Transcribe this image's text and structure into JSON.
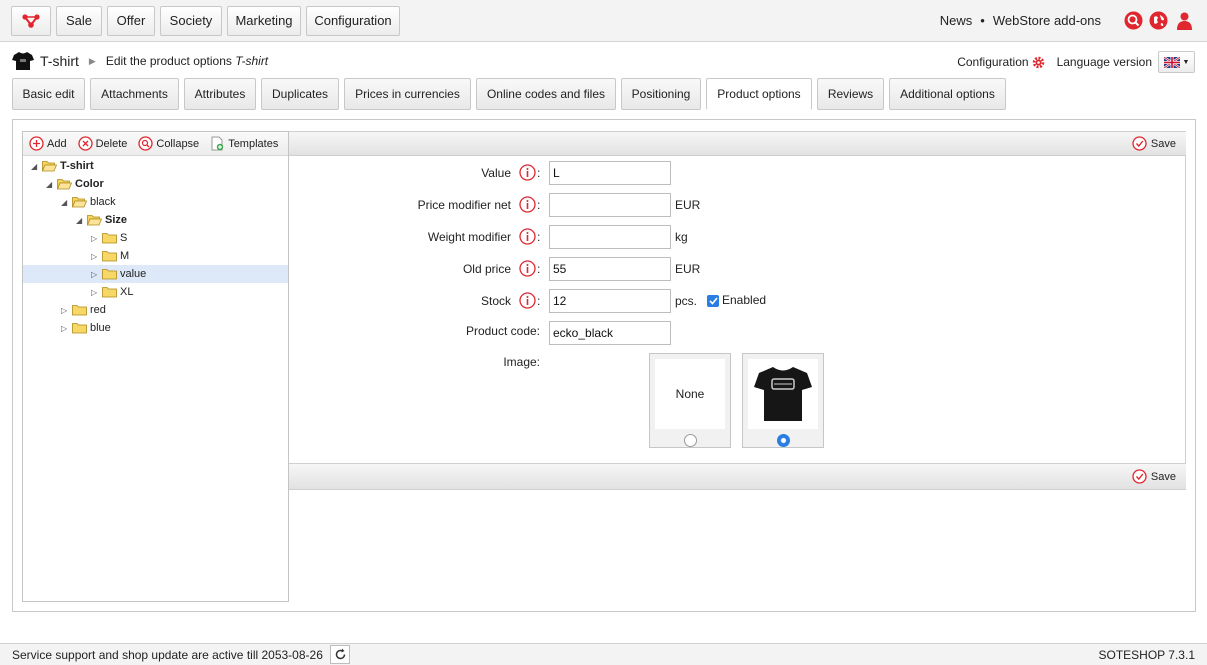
{
  "topnav": {
    "items": [
      "Sale",
      "Offer",
      "Society",
      "Marketing",
      "Configuration"
    ],
    "links": [
      "News",
      "WebStore add-ons"
    ],
    "separator": "•"
  },
  "breadcrumb": {
    "product": "T-shirt",
    "action": "Edit the product options",
    "product_italic": "T-shirt"
  },
  "right_header": {
    "configuration": "Configuration",
    "language_version": "Language version"
  },
  "tabs": [
    "Basic edit",
    "Attachments",
    "Attributes",
    "Duplicates",
    "Prices in currencies",
    "Online codes and files",
    "Positioning",
    "Product options",
    "Reviews",
    "Additional options"
  ],
  "active_tab": "Product options",
  "tree_toolbar": {
    "add": "Add",
    "delete": "Delete",
    "collapse": "Collapse",
    "templates": "Templates"
  },
  "tree": [
    {
      "label": "T-shirt",
      "level": 0,
      "expanded": true,
      "bold": true
    },
    {
      "label": "Color",
      "level": 1,
      "expanded": true,
      "bold": true
    },
    {
      "label": "black",
      "level": 2,
      "expanded": true,
      "bold": false
    },
    {
      "label": "Size",
      "level": 3,
      "expanded": true,
      "bold": true
    },
    {
      "label": "S",
      "level": 4,
      "expanded": false,
      "bold": false
    },
    {
      "label": "M",
      "level": 4,
      "expanded": false,
      "bold": false
    },
    {
      "label": "value",
      "level": 4,
      "expanded": false,
      "bold": false,
      "selected": true
    },
    {
      "label": "XL",
      "level": 4,
      "expanded": false,
      "bold": false
    },
    {
      "label": "red",
      "level": 2,
      "expanded": false,
      "bold": false
    },
    {
      "label": "blue",
      "level": 2,
      "expanded": false,
      "bold": false
    }
  ],
  "save_label": "Save",
  "form": {
    "value": {
      "label": "Value",
      "value": "L"
    },
    "price_modifier": {
      "label": "Price modifier net",
      "value": "",
      "unit": "EUR"
    },
    "weight_modifier": {
      "label": "Weight modifier",
      "value": "",
      "unit": "kg"
    },
    "old_price": {
      "label": "Old price",
      "value": "55",
      "unit": "EUR"
    },
    "stock": {
      "label": "Stock",
      "value": "12",
      "unit": "pcs.",
      "enabled_label": "Enabled",
      "enabled": true
    },
    "product_code": {
      "label": "Product code:",
      "value": "ecko_black"
    },
    "image": {
      "label": "Image:",
      "none_label": "None",
      "selected": "tshirt"
    }
  },
  "colon": ":",
  "footer": {
    "support": "Service support and shop update are active till 2053-08-26",
    "version": "SOTESHOP 7.3.1"
  },
  "colors": {
    "accent_red": "#e0262e",
    "selected_row": "#dde9f8",
    "radio_blue": "#2a7de1"
  }
}
